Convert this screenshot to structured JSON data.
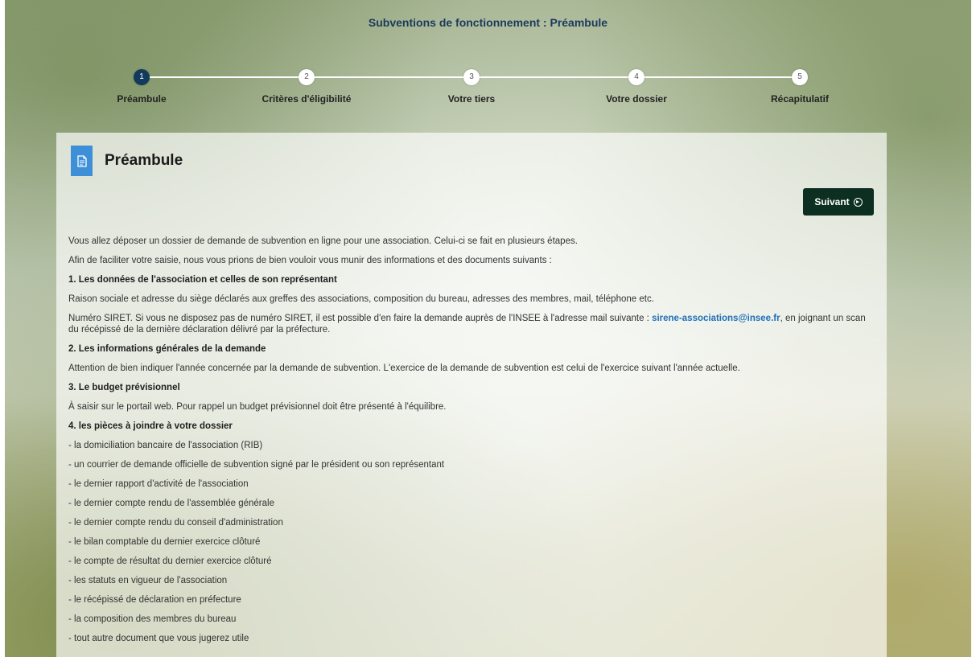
{
  "page": {
    "title": "Subventions de fonctionnement : Préambule"
  },
  "stepper": {
    "steps": [
      {
        "number": "1",
        "label": "Préambule"
      },
      {
        "number": "2",
        "label": "Critères d'éligibilité"
      },
      {
        "number": "3",
        "label": "Votre tiers"
      },
      {
        "number": "4",
        "label": "Votre dossier"
      },
      {
        "number": "5",
        "label": "Récapitulatif"
      }
    ],
    "active_step": 1
  },
  "panel": {
    "title": "Préambule",
    "icon": "document-icon",
    "next_label": "Suivant",
    "next_icon": "arrow-circle-right-icon"
  },
  "content": {
    "intro": "Vous allez déposer un dossier de demande de subvention en ligne pour une association. Celui-ci se fait en plusieurs étapes.",
    "intro2": "Afin de faciliter votre saisie, nous vous prions de bien vouloir vous munir des informations et des documents suivants :",
    "s1_title": "1. Les données de l'association et celles de son représentant",
    "s1_p1": "Raison sociale et adresse du siège déclarés aux greffes des associations, composition du bureau, adresses des membres, mail, téléphone etc.",
    "s1_p2_a": "Numéro SIRET. Si vous ne disposez pas de numéro SIRET, il est possible d'en faire la demande auprès de l'INSEE à l'adresse mail suivante : ",
    "s1_email": "sirene-associations@insee.fr",
    "s1_p2_b": ", en joignant un scan du récépissé de la dernière déclaration délivré par la préfecture.",
    "s2_title": "2. Les informations générales de la demande",
    "s2_p": "Attention de bien indiquer l'année concernée par la demande de subvention. L'exercice de la demande de subvention est celui de l'exercice suivant l'année actuelle.",
    "s3_title": "3. Le budget prévisionnel",
    "s3_p": "À saisir sur le portail web. Pour rappel un budget prévisionnel doit être présenté à l'équilibre.",
    "s4_title": "4. les pièces à joindre à votre dossier",
    "s4_items": [
      "- la domiciliation bancaire de l'association (RIB)",
      "- un courrier de demande officielle de subvention signé par le président ou son représentant",
      "- le dernier rapport d'activité de l'association",
      "- le dernier compte rendu de l'assemblée générale",
      "- le dernier compte rendu du conseil d'administration",
      "- le bilan comptable du dernier exercice clôturé",
      "- le compte de résultat du dernier exercice clôturé",
      "- les statuts en vigueur de l'association",
      "- le récépissé de déclaration en préfecture",
      "- la composition des membres du bureau",
      "- tout autre document que vous jugerez utile"
    ]
  },
  "colors": {
    "accent_dark": "#123a5c",
    "button_bg": "#0d2f22",
    "icon_bg": "#3d8fd8",
    "link": "#1f6fb7"
  }
}
